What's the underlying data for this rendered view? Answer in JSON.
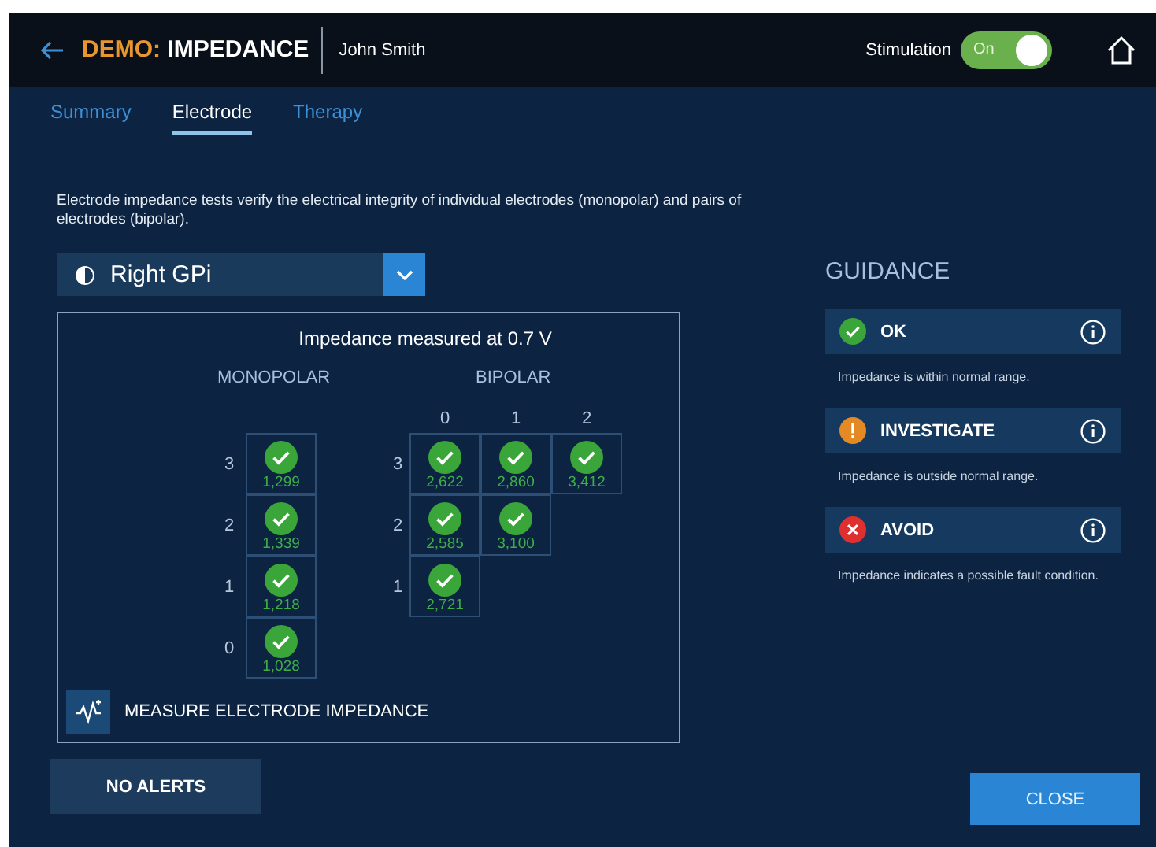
{
  "header": {
    "title_prefix": "DEMO:",
    "title": "IMPEDANCE",
    "patient": "John Smith",
    "stimulation": {
      "label": "Stimulation",
      "on": true,
      "state_label": "On"
    }
  },
  "tabs": [
    {
      "label": "Summary",
      "selected": false
    },
    {
      "label": "Electrode",
      "selected": true
    },
    {
      "label": "Therapy",
      "selected": false
    }
  ],
  "description": "Electrode impedance tests verify the electrical integrity of individual electrodes (monopolar) and pairs of electrodes (bipolar).",
  "lead_select": {
    "value": "Right GPi"
  },
  "impedance": {
    "title": "Impedance measured at 0.7 V",
    "monopolar": {
      "heading": "MONOPOLAR",
      "rows": [
        {
          "label": "3",
          "cell": {
            "kind": "ok",
            "value": "1,299"
          }
        },
        {
          "label": "2",
          "cell": {
            "kind": "ok",
            "value": "1,339"
          }
        },
        {
          "label": "1",
          "cell": {
            "kind": "ok",
            "value": "1,218"
          }
        },
        {
          "label": "0",
          "cell": {
            "kind": "ok",
            "value": "1,028"
          }
        }
      ]
    },
    "bipolar": {
      "heading": "BIPOLAR",
      "columns": [
        "0",
        "1",
        "2"
      ],
      "rows": [
        {
          "label": "3",
          "cells": [
            {
              "kind": "ok",
              "value": "2,622"
            },
            {
              "kind": "ok",
              "value": "2,860"
            },
            {
              "kind": "ok",
              "value": "3,412"
            }
          ]
        },
        {
          "label": "2",
          "cells": [
            {
              "kind": "ok",
              "value": "2,585"
            },
            {
              "kind": "ok",
              "value": "3,100"
            }
          ]
        },
        {
          "label": "1",
          "cells": [
            {
              "kind": "ok",
              "value": "2,721"
            }
          ]
        }
      ]
    },
    "measure_button": "MEASURE ELECTRODE IMPEDANCE"
  },
  "guidance": {
    "heading": "GUIDANCE",
    "items": [
      {
        "kind": "ok",
        "label": "OK",
        "description": "Impedance is within normal range."
      },
      {
        "kind": "investigate",
        "label": "INVESTIGATE",
        "description": "Impedance is outside normal range."
      },
      {
        "kind": "avoid",
        "label": "AVOID",
        "description": "Impedance indicates a possible fault condition."
      }
    ]
  },
  "buttons": {
    "alerts": "NO ALERTS",
    "close": "CLOSE"
  }
}
